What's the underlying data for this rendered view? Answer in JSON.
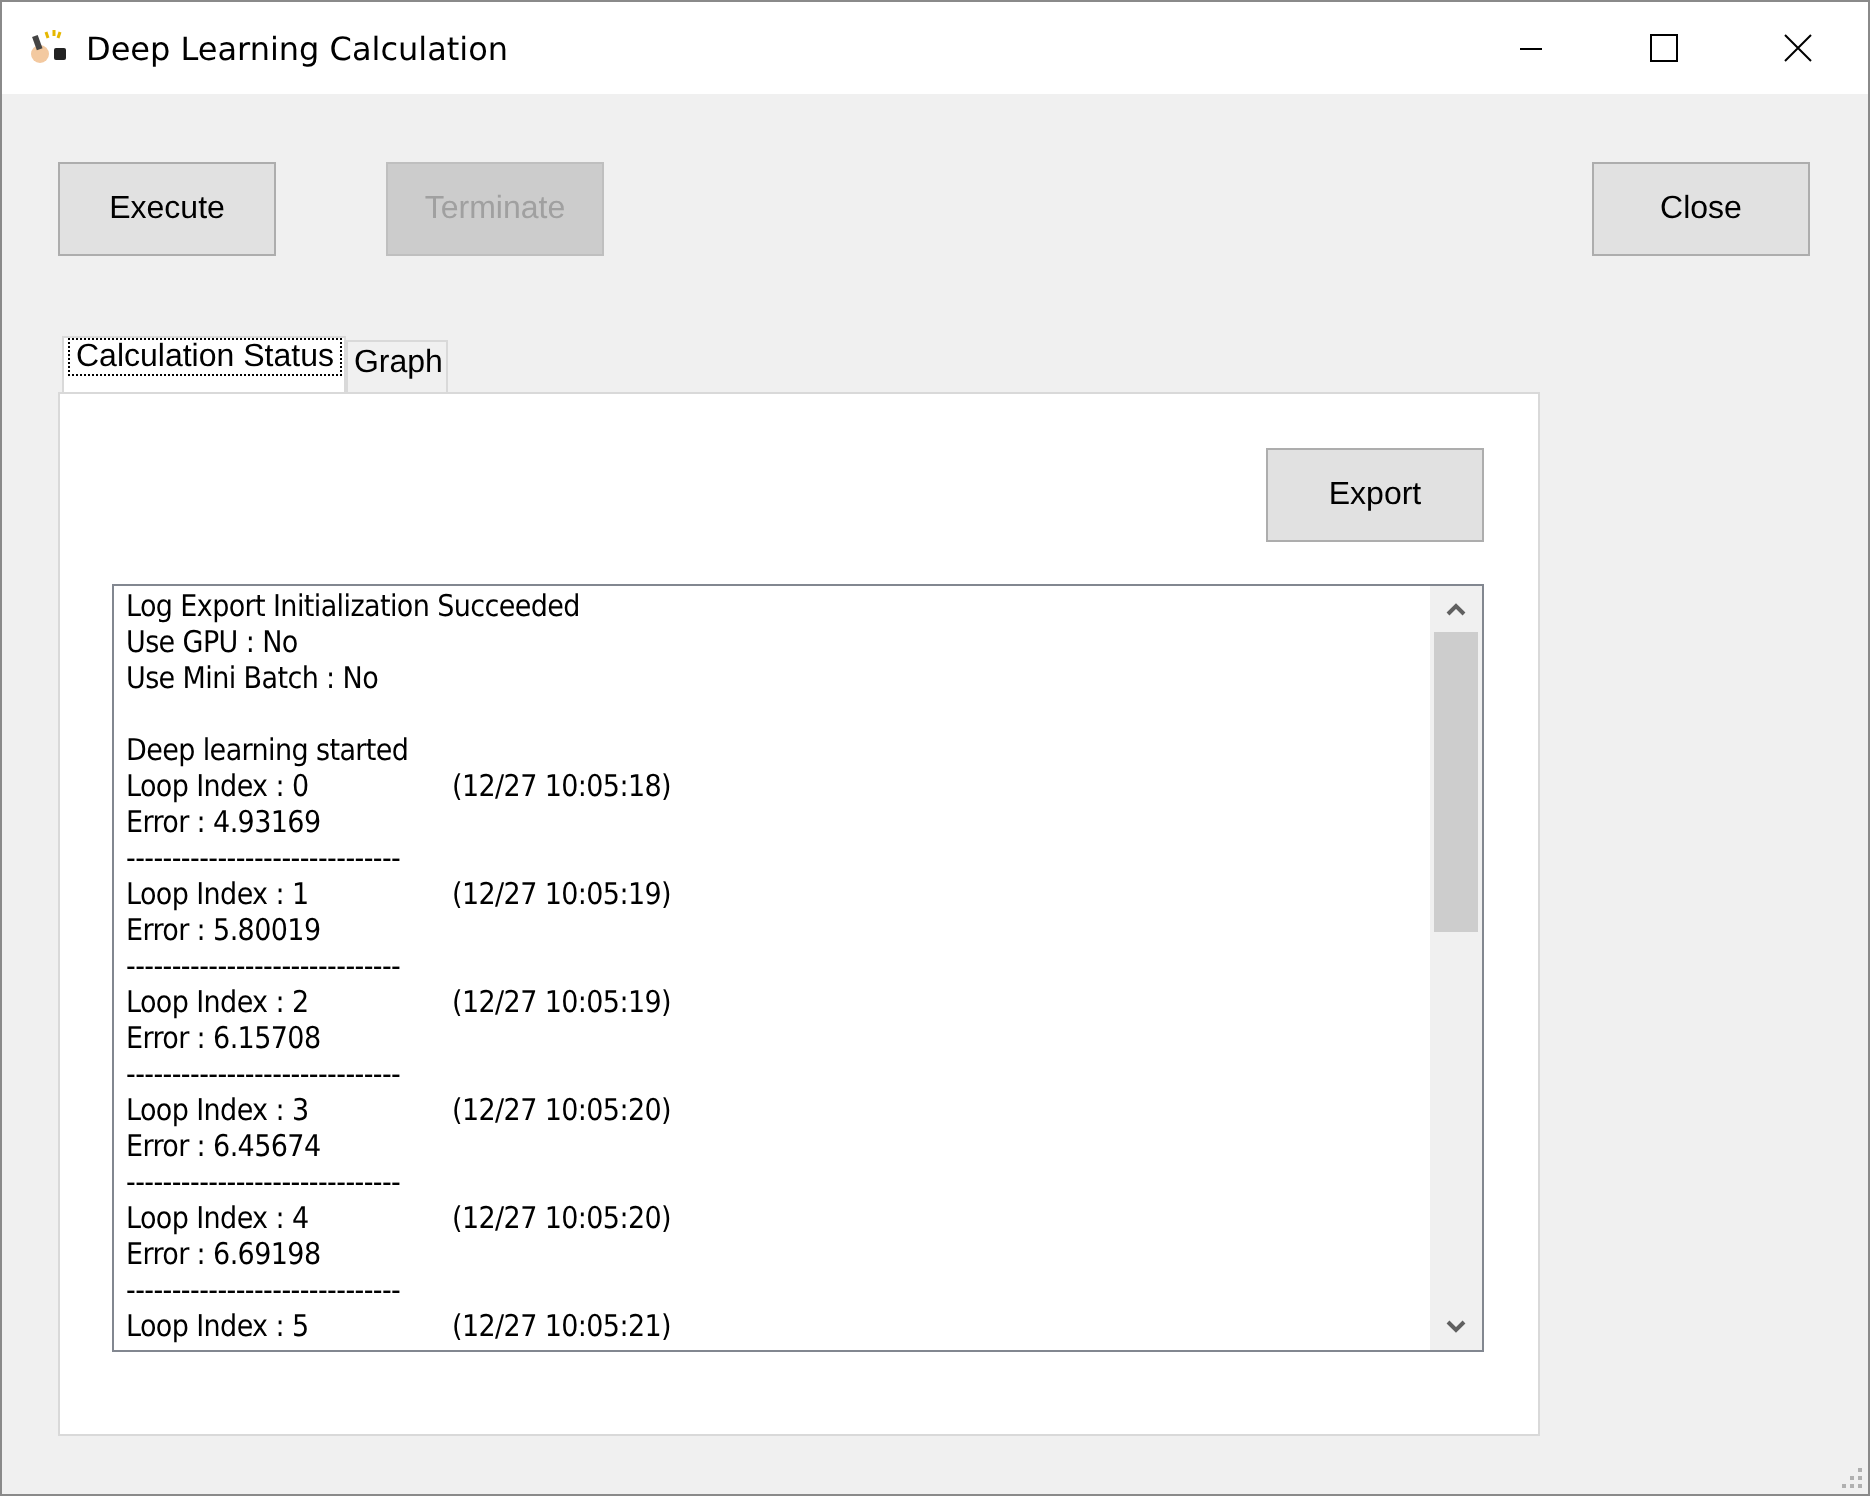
{
  "window": {
    "title": "Deep Learning Calculation"
  },
  "buttons": [
    {
      "label": "Execute",
      "disabled": false
    },
    {
      "label": "Terminate",
      "disabled": true
    }
  ],
  "close_button": {
    "label": "Close"
  },
  "tabs": [
    {
      "label": "Calculation Status",
      "selected": true
    },
    {
      "label": "Graph",
      "selected": false
    }
  ],
  "export_button": {
    "label": "Export"
  },
  "log": [
    {
      "kind": "text",
      "text": "Log Export Initialization Succeeded"
    },
    {
      "kind": "text",
      "text": "Use GPU : No"
    },
    {
      "kind": "text",
      "text": "Use Mini Batch : No"
    },
    {
      "kind": "blank"
    },
    {
      "kind": "text",
      "text": "Deep learning started"
    },
    {
      "kind": "loop",
      "text": "Loop Index : 0",
      "time": "(12/27 10:05:18)"
    },
    {
      "kind": "text",
      "text": "Error : 4.93169"
    },
    {
      "kind": "text",
      "text": "------------------------------"
    },
    {
      "kind": "loop",
      "text": "Loop Index : 1",
      "time": "(12/27 10:05:19)"
    },
    {
      "kind": "text",
      "text": "Error : 5.80019"
    },
    {
      "kind": "text",
      "text": "------------------------------"
    },
    {
      "kind": "loop",
      "text": "Loop Index : 2",
      "time": "(12/27 10:05:19)"
    },
    {
      "kind": "text",
      "text": "Error : 6.15708"
    },
    {
      "kind": "text",
      "text": "------------------------------"
    },
    {
      "kind": "loop",
      "text": "Loop Index : 3",
      "time": "(12/27 10:05:20)"
    },
    {
      "kind": "text",
      "text": "Error : 6.45674"
    },
    {
      "kind": "text",
      "text": "------------------------------"
    },
    {
      "kind": "loop",
      "text": "Loop Index : 4",
      "time": "(12/27 10:05:20)"
    },
    {
      "kind": "text",
      "text": "Error : 6.69198"
    },
    {
      "kind": "text",
      "text": "------------------------------"
    },
    {
      "kind": "loop",
      "text": "Loop Index : 5",
      "time": "(12/27 10:05:21)"
    }
  ]
}
